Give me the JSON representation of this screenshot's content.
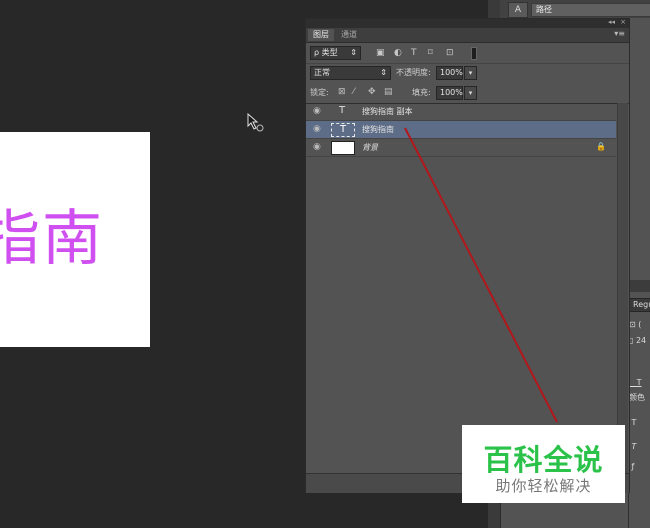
{
  "document": {
    "visible_text": "指南",
    "text_color": "#d04ff0"
  },
  "dock": {
    "paths_icon": "A",
    "paths_label": "路径"
  },
  "layers_panel": {
    "tabs": [
      {
        "label": "图层"
      },
      {
        "label": "通道"
      }
    ],
    "filter": {
      "kind_label": "ρ 类型",
      "icons": [
        "image-filter-icon",
        "adjustment-filter-icon",
        "type-filter-icon",
        "shape-filter-icon",
        "smart-object-filter-icon"
      ]
    },
    "blend_mode": "正常",
    "opacity_label": "不透明度:",
    "opacity_value": "100%",
    "lock_label": "锁定:",
    "fill_label": "填充:",
    "fill_value": "100%",
    "layers": [
      {
        "name": "搜狗指南 副本",
        "type_icon": "T",
        "selected": false
      },
      {
        "name": "搜狗指南",
        "type_icon": "T",
        "selected": true
      },
      {
        "name": "背景",
        "type_icon": "",
        "selected": false
      }
    ]
  },
  "character_panel": {
    "font_style": "Regu",
    "size": "24",
    "color_label": "颜色"
  },
  "watermark": {
    "title": "百科全说",
    "subtitle": "助你轻松解决"
  },
  "colors": {
    "annotation_line": "#b1171b",
    "selected_layer": "#5d6c87",
    "watermark_green": "#2bc24a"
  }
}
